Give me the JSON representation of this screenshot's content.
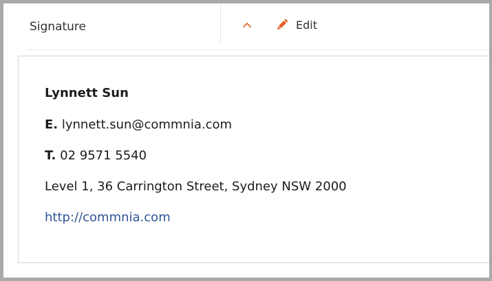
{
  "header": {
    "title": "Signature",
    "edit_label": "Edit",
    "collapse_icon": "chevron-up-icon",
    "edit_icon": "pencil-icon",
    "accent_color": "#e8622c"
  },
  "signature": {
    "name": "Lynnett Sun",
    "email_prefix": "E.",
    "email": "lynnett.sun@commnia.com",
    "phone_prefix": "T.",
    "phone": "02 9571 5540",
    "address": "Level 1, 36 Carrington Street, Sydney NSW 2000",
    "website": "http://commnia.com",
    "link_color": "#2f5496"
  }
}
